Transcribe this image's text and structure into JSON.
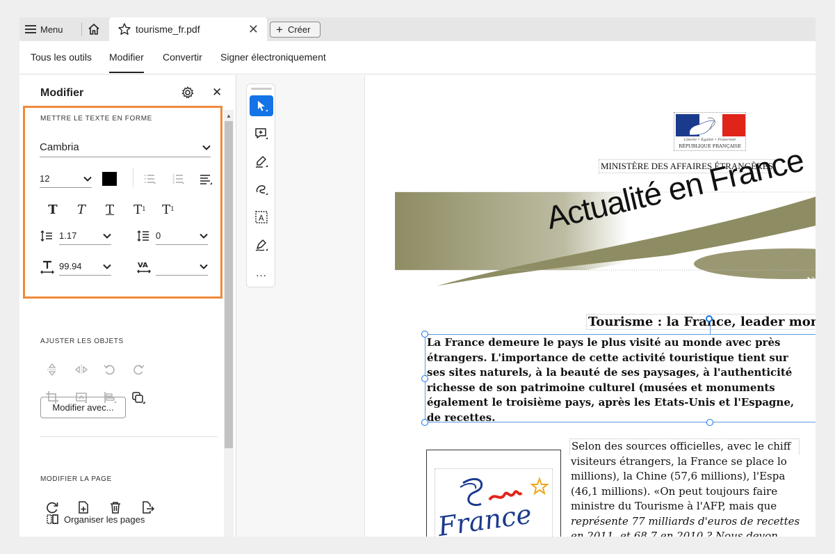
{
  "tabbar": {
    "menu_label": "Menu",
    "file_tab": "tourisme_fr.pdf",
    "create_label": "Créer",
    "close_glyph": "✕"
  },
  "toolnav": {
    "items": [
      "Tous les outils",
      "Modifier",
      "Convertir",
      "Signer électroniquement"
    ],
    "active": "Modifier"
  },
  "panel": {
    "title": "Modifier",
    "close_glyph": "✕",
    "format_section": "METTRE LE TEXTE EN FORME",
    "font_family": "Cambria",
    "font_size": "12",
    "line_spacing": "1.17",
    "para_spacing": "0",
    "horiz_scale": "99.94",
    "char_spacing": "",
    "text_color": "#000000",
    "objects_section": "AJUSTER LES OBJETS",
    "edit_with_label": "Modifier avec...",
    "page_section": "MODIFIER LA PAGE",
    "organize_label": "Organiser les pages",
    "highlight_color": "#ef8a3a"
  },
  "toolbar": {
    "more_label": "..."
  },
  "document": {
    "logo_motto": "Liberté • Égalité • Fraternité",
    "logo_name": "RÉPUBLIQUE FRANÇAISE",
    "ministry": "MINISTÈRE DES AFFAIRES ÉTRANGÈRES",
    "banner_title": "Actualité en France",
    "banner_letter": "N",
    "headline": "Tourisme : la France, leader mon",
    "selected_paragraph": [
      "La France demeure le pays le plus visité au monde avec près",
      "étrangers. L'importance de cette activité touristique tient sur",
      "ses sites naturels, à la beauté de ses paysages, à l'authenticité",
      "richesse de son patrimoine culturel (musées et monuments",
      "également le troisième pays, après les Etats-Unis et l'Espagne,",
      "de recettes."
    ],
    "body_lines": [
      "Selon des sources officielles, avec le chiff",
      "visiteurs étrangers, la France se place lo",
      "millions), la Chine (57,6 millions), l'Espa",
      "(46,1 millions). «On peut toujours faire",
      "ministre du Tourisme à l'AFP, mais que",
      "représente 77 milliards d'euros de recettes",
      "en 2011, et 68,7 en 2010 ? Nous devon"
    ],
    "france_logo_text": "France"
  }
}
